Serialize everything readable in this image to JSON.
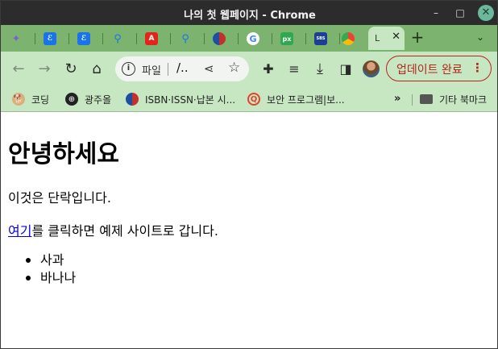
{
  "window": {
    "title": "나의 첫 웹페이지 - Chrome"
  },
  "tabs": [
    {
      "icon": "sparkle-icon",
      "color": "#8a6fd1",
      "glyph": "✦"
    },
    {
      "icon": "e-blue-icon",
      "color": "#1a73e8",
      "glyph": "ℰ"
    },
    {
      "icon": "e-blue-icon",
      "color": "#1a73e8",
      "glyph": "ℰ"
    },
    {
      "icon": "search-icon",
      "color": "#1a73e8",
      "glyph": "⚲"
    },
    {
      "icon": "adobe-icon",
      "color": "#e1251b",
      "glyph": "A"
    },
    {
      "icon": "search-icon",
      "color": "#1a73e8",
      "glyph": "⚲"
    },
    {
      "icon": "korea-gov-icon",
      "color": "#c4302b",
      "glyph": "◐"
    },
    {
      "icon": "google-icon",
      "color": "#4285f4",
      "glyph": "G"
    },
    {
      "icon": "px-icon",
      "color": "#2fa84f",
      "glyph": "px"
    },
    {
      "icon": "sbs-news-icon",
      "color": "#1c3f94",
      "glyph": "SBS"
    },
    {
      "icon": "chrome-icon",
      "color": "#f4b400",
      "glyph": "◉"
    }
  ],
  "active_tab": {
    "label": "L"
  },
  "toolbar": {
    "omnibox_chip": "파일",
    "omnibox_url": "/..",
    "update_label": "업데이트 완료"
  },
  "bookmarks": [
    {
      "label": "코딩",
      "icon": "dog-icon"
    },
    {
      "label": "광주올",
      "icon": "globe-icon"
    },
    {
      "label": "ISBN·ISSN·납본 시...",
      "icon": "korea-gov-icon"
    },
    {
      "label": "보안 프로그램|보...",
      "icon": "q-logo-icon"
    }
  ],
  "bookmarks_other": "기타 북마크",
  "page": {
    "heading": "안녕하세요",
    "paragraph": "이것은 단락입니다.",
    "link_text": "여기",
    "link_suffix": "를 클릭하면 예제 사이트로 갑니다.",
    "list_items": [
      "사과",
      "바나나"
    ]
  }
}
